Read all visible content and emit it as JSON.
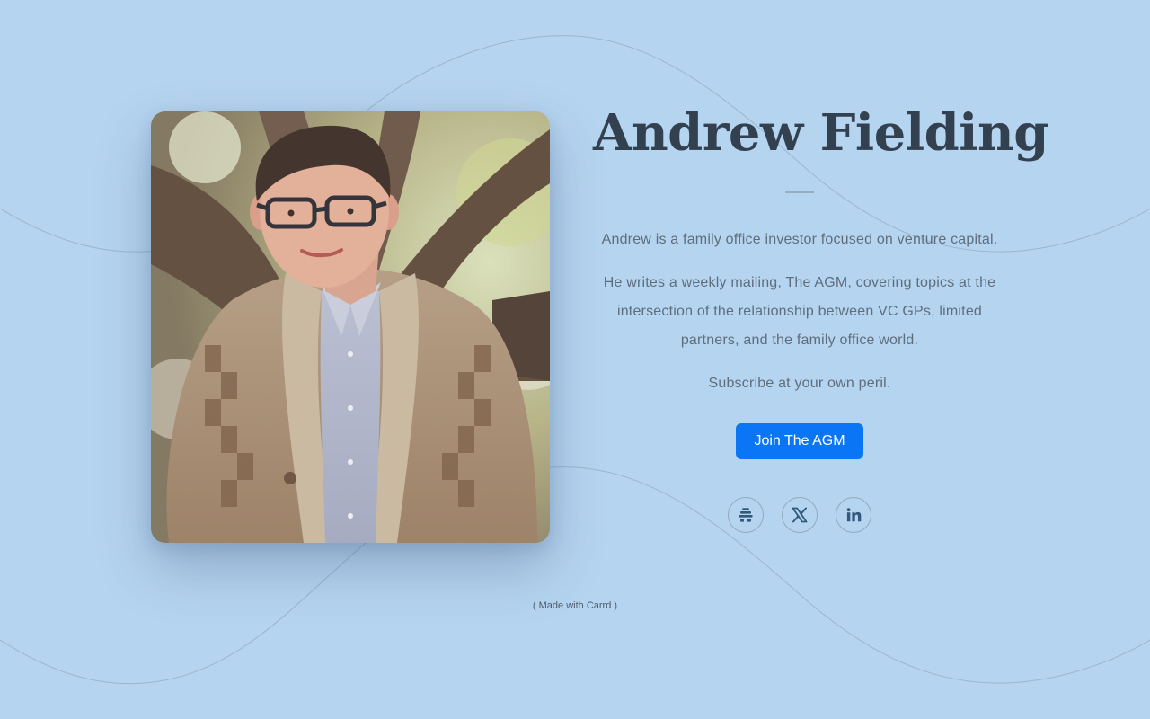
{
  "profile": {
    "name": "Andrew Fielding",
    "photo_alt": "Andrew Fielding"
  },
  "bio": {
    "paragraphs": [
      "Andrew is a family office investor focused on venture capital.",
      "He writes a weekly mailing, The AGM, covering topics at the intersection of the relationship between VC GPs, limited partners, and the family office world.",
      "Subscribe at your own peril."
    ]
  },
  "cta": {
    "label": "Join The AGM",
    "color": "#0a76f6"
  },
  "socials": [
    {
      "icon": "beehiiv-icon"
    },
    {
      "icon": "x-icon"
    },
    {
      "icon": "linkedin-icon"
    }
  ],
  "footer": {
    "text": "( Made with Carrd )"
  },
  "theme": {
    "background": "#b5d4ef",
    "heading": "#33404f",
    "body_text": "#5f6e7d"
  }
}
